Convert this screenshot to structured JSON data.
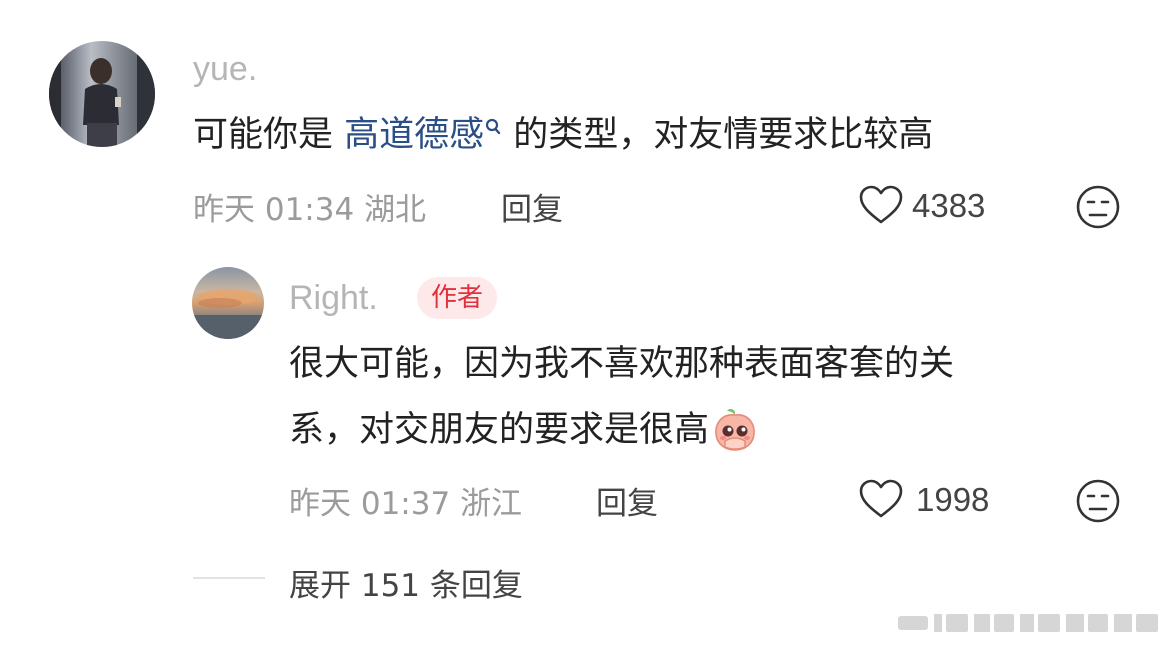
{
  "comment": {
    "username": "yue.",
    "content_prefix": "可能你是 ",
    "highlight": "高道德感",
    "content_suffix": " 的类型，对友情要求比较高",
    "time": "昨天 01:34",
    "location": "湖北",
    "reply_label": "回复",
    "likes": "4383"
  },
  "reply": {
    "username": "Right.",
    "author_badge": "作者",
    "line1": "很大可能，因为我不喜欢那种表面客套的关",
    "line2": "系，对交朋友的要求是很高",
    "time": "昨天 01:37",
    "location": "浙江",
    "reply_label": "回复",
    "likes": "1998"
  },
  "expand_replies": "展开 151 条回复",
  "icons": {
    "search": "search-icon",
    "like": "heart-icon",
    "dislike": "meh-face-icon",
    "emoji": "peach-emoji-icon"
  }
}
